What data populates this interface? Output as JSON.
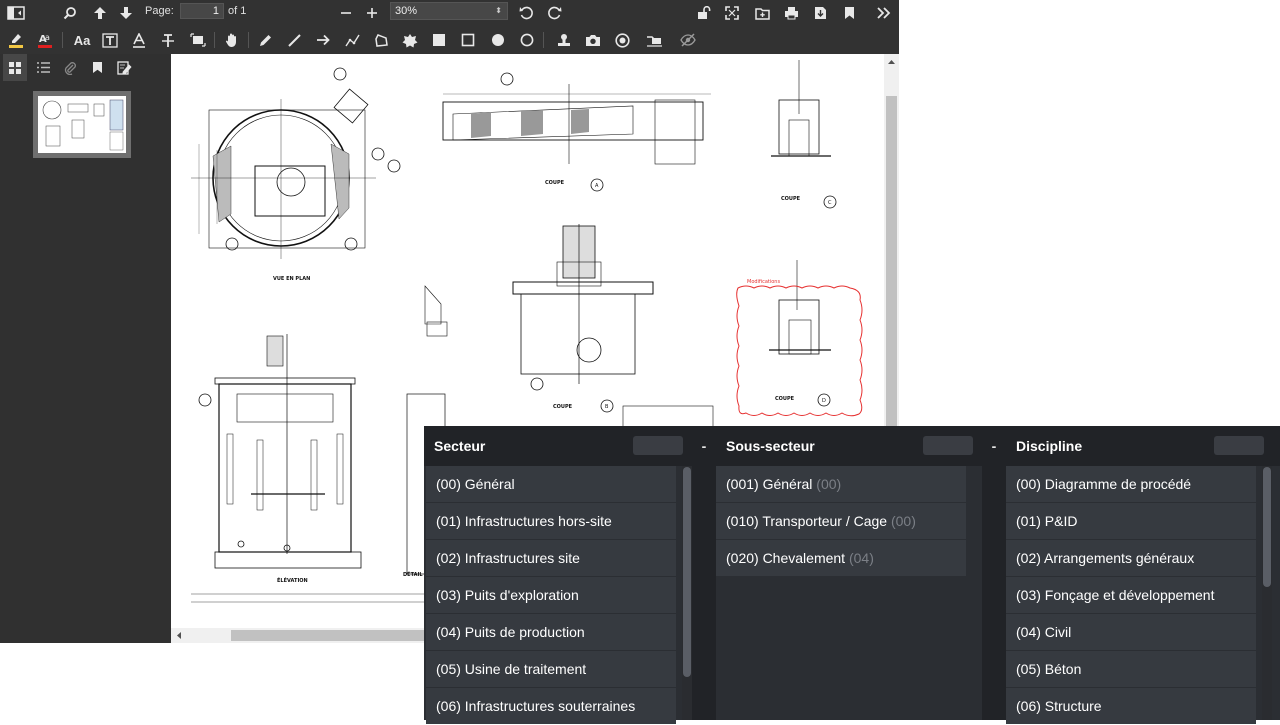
{
  "toolbar": {
    "page_label": "Page:",
    "page_value": "1",
    "page_total": "of 1",
    "zoom_value": "30%",
    "zoom_arrow": "⬍",
    "annotation_text_tool": "Aa"
  },
  "filters": {
    "columns": [
      {
        "title": "Secteur",
        "items": [
          {
            "label": "(00) Général",
            "count": ""
          },
          {
            "label": "(01) Infrastructures hors-site",
            "count": ""
          },
          {
            "label": "(02) Infrastructures site",
            "count": ""
          },
          {
            "label": "(03) Puits d'exploration",
            "count": ""
          },
          {
            "label": "(04) Puits de production",
            "count": ""
          },
          {
            "label": "(05) Usine de traitement",
            "count": ""
          },
          {
            "label": "(06) Infrastructures souterraines",
            "count": ""
          }
        ]
      },
      {
        "title": "Sous-secteur",
        "items": [
          {
            "label": "(001) Général",
            "count": "(00)"
          },
          {
            "label": "(010) Transporteur / Cage",
            "count": "(00)"
          },
          {
            "label": "(020) Chevalement",
            "count": "(04)"
          }
        ]
      },
      {
        "title": "Discipline",
        "items": [
          {
            "label": "(00) Diagramme de procédé",
            "count": ""
          },
          {
            "label": "(01) P&ID",
            "count": ""
          },
          {
            "label": "(02) Arrangements généraux",
            "count": ""
          },
          {
            "label": "(03) Fonçage et développement",
            "count": ""
          },
          {
            "label": "(04) Civil",
            "count": ""
          },
          {
            "label": "(05) Béton",
            "count": ""
          },
          {
            "label": "(06) Structure",
            "count": ""
          }
        ]
      }
    ],
    "separator": "-"
  },
  "drawing": {
    "labels": {
      "plan": "VUE EN PLAN",
      "elevation": "ÉLÉVATION",
      "detail": "DÉTAIL",
      "section_a": "COUPE",
      "section_b": "COUPE",
      "section_c": "COUPE",
      "section_d": "COUPE",
      "modifications": "Modifications",
      "mark_a": "A",
      "mark_b": "B",
      "mark_c": "C",
      "mark_d": "D"
    }
  },
  "colors": {
    "toolbar": "#323232",
    "panel": "#212327",
    "item": "#363a40",
    "highlight_red": "#e63030",
    "eraser_red": "#e02020"
  }
}
